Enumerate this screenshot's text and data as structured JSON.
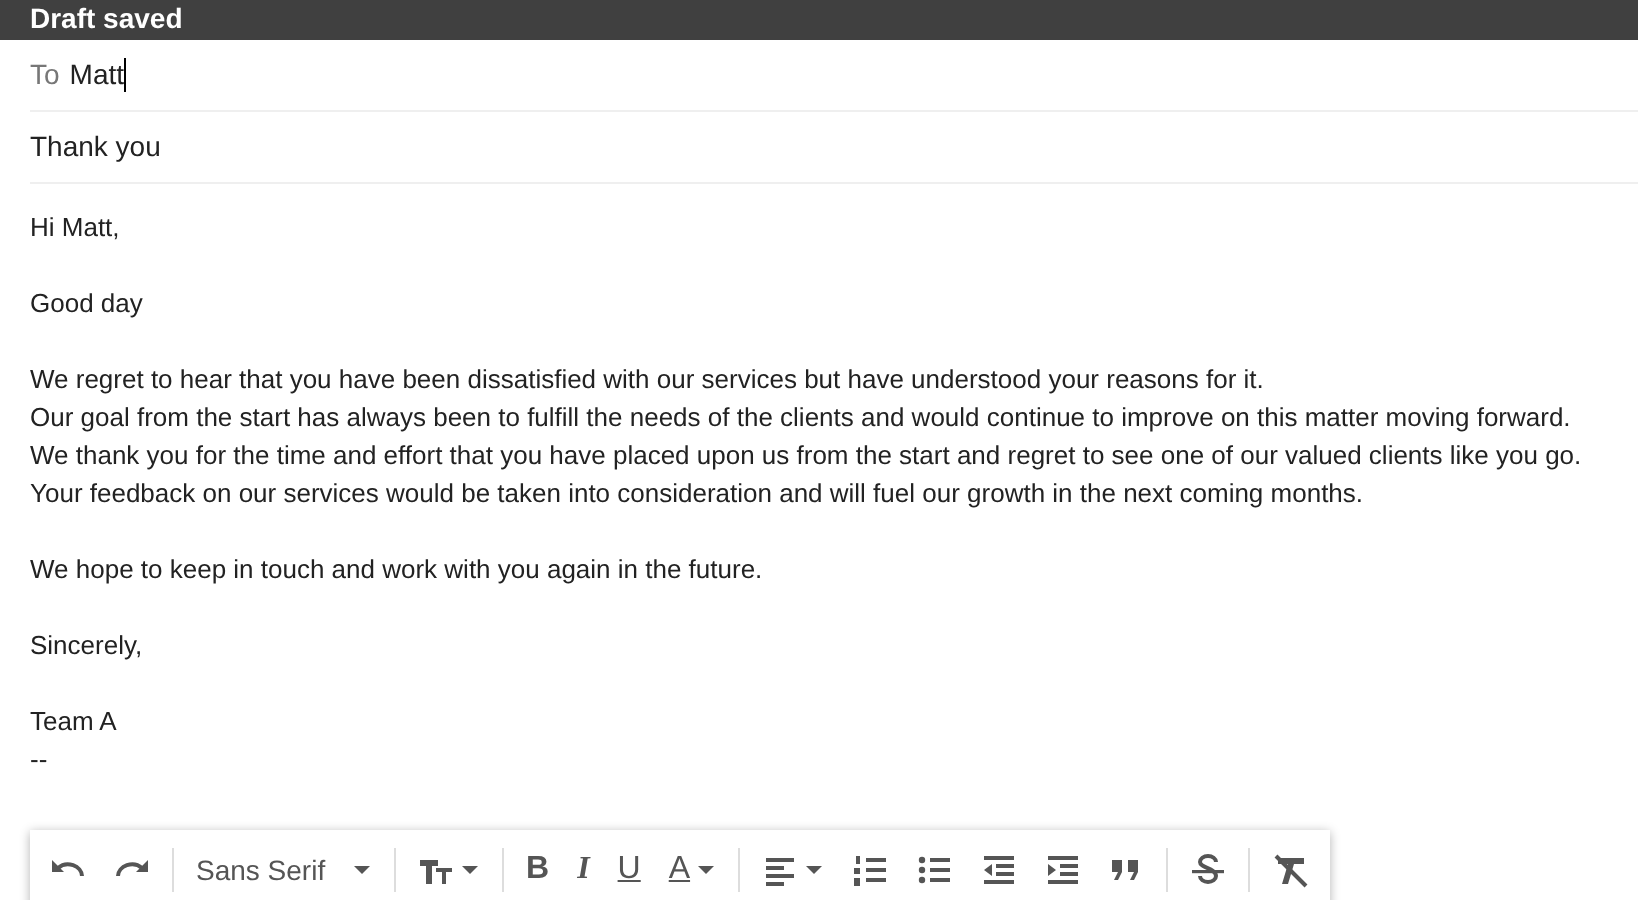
{
  "header": {
    "title": "Draft saved"
  },
  "to": {
    "label": "To",
    "value": "Matt"
  },
  "subject": {
    "value": "Thank you"
  },
  "body": [
    [
      "Hi Matt,"
    ],
    [
      "Good day"
    ],
    [
      "We regret to hear that you have been dissatisfied with our services but have understood your reasons for it.",
      "Our goal from the start has always been to fulfill the needs of the clients and would continue to improve on this matter moving forward.",
      "We thank you for the time and effort that you have placed upon us from the start and regret to see one of our valued clients like you go.",
      "Your feedback on our services would be taken into consideration and will fuel our growth in the next coming months."
    ],
    [
      "We hope to keep in touch and work with you again in the future."
    ],
    [
      "Sincerely,"
    ],
    [
      "Team A",
      "--"
    ]
  ],
  "toolbar": {
    "font": "Sans Serif",
    "letters": [
      "B",
      "I",
      "U",
      "A"
    ]
  }
}
